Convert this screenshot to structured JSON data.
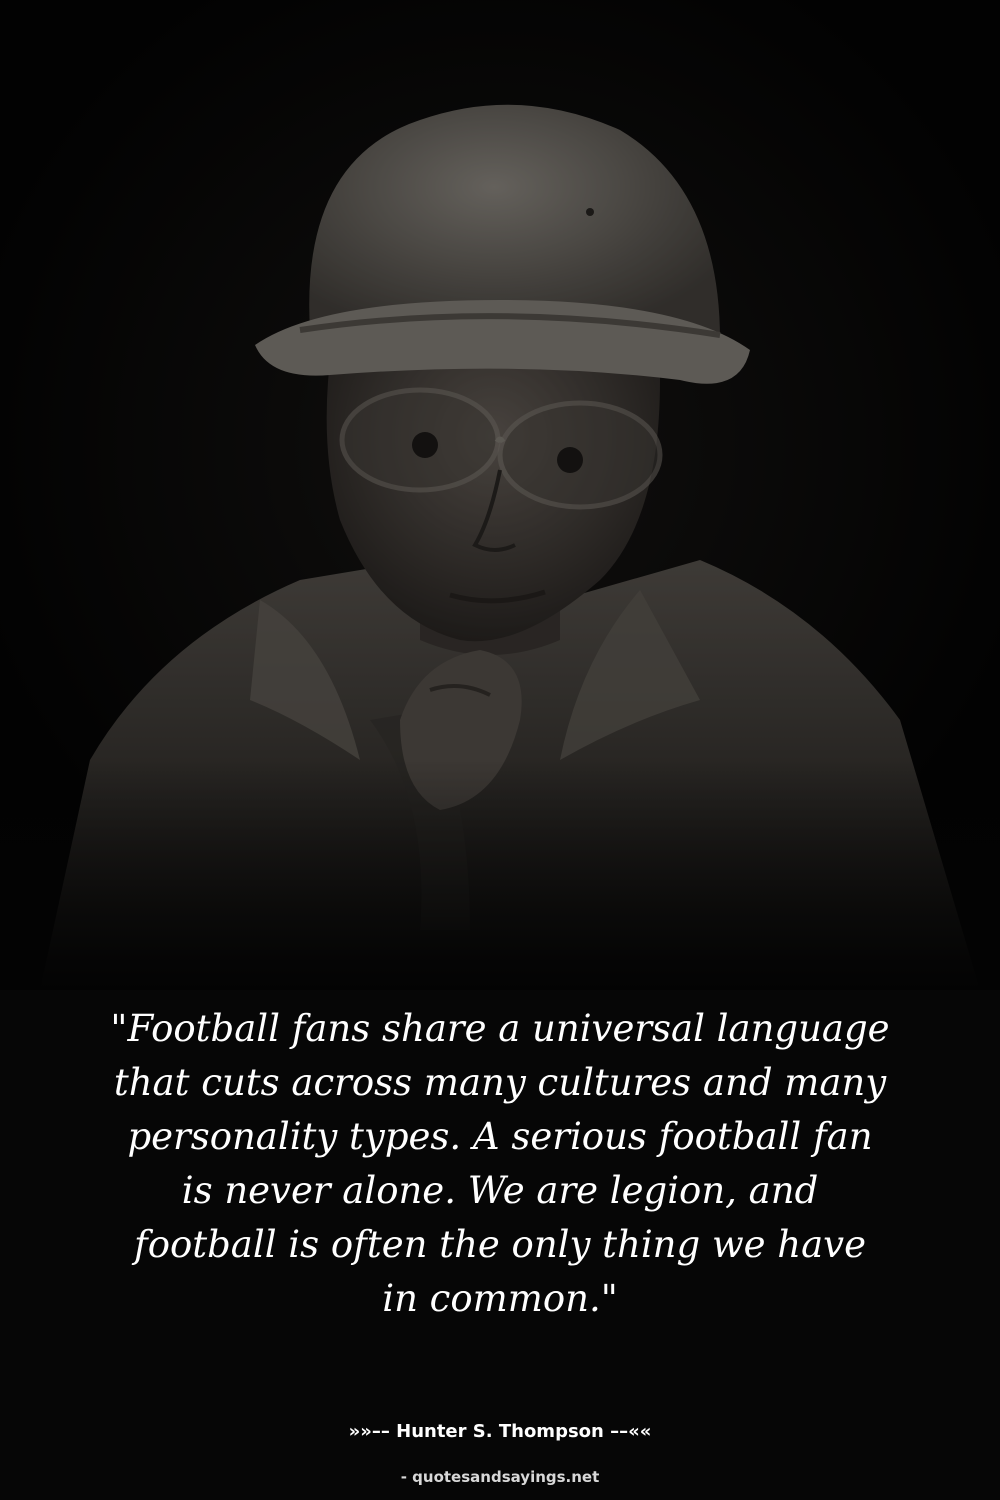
{
  "quote": {
    "lines": [
      "\"Football fans share a universal language",
      "that cuts across many cultures and many",
      "personality types. A serious football fan",
      "is never alone. We are legion, and",
      "football is often the only thing we have",
      "in common.\""
    ]
  },
  "attribution": {
    "author_line": "»»–– Hunter S. Thompson ––««"
  },
  "source": {
    "credit": "- quotesandsayings.net"
  },
  "colors": {
    "background": "#060606",
    "text": "#ffffff",
    "photo_tone": "#8a847c"
  }
}
